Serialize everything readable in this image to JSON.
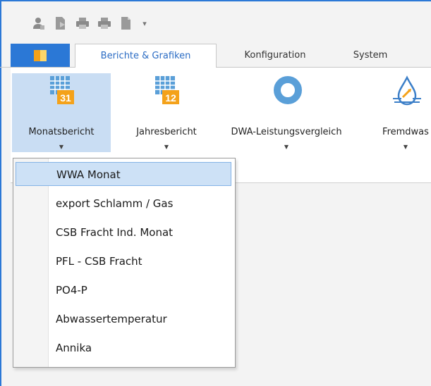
{
  "quick_access": {
    "icons": [
      "user-icon",
      "export-icon",
      "print-icon",
      "print-preview-icon",
      "document-icon"
    ],
    "customize_glyph": "▾"
  },
  "tabs": [
    {
      "label": "Berichte & Grafiken",
      "active": true
    },
    {
      "label": "Konfiguration",
      "active": false
    },
    {
      "label": "System",
      "active": false
    }
  ],
  "ribbon": {
    "buttons": [
      {
        "label": "Monatsbericht",
        "icon": "calendar-31-icon",
        "badge": "31",
        "has_dropdown": true,
        "pressed": true
      },
      {
        "label": "Jahresbericht",
        "icon": "calendar-12-icon",
        "badge": "12",
        "has_dropdown": true
      },
      {
        "label": "DWA-Leistungsvergleich",
        "icon": "ring-chart-icon",
        "has_dropdown": true
      },
      {
        "label": "Fremdwas",
        "icon": "water-drop-icon",
        "has_dropdown": true
      }
    ],
    "arrow_glyph": "▼"
  },
  "menu": {
    "items": [
      {
        "label": "WWA Monat",
        "highlighted": true
      },
      {
        "label": "export Schlamm / Gas"
      },
      {
        "label": "CSB Fracht Ind. Monat"
      },
      {
        "label": "PFL - CSB Fracht"
      },
      {
        "label": "PO4-P"
      },
      {
        "label": "Abwassertemperatur"
      },
      {
        "label": "Annika"
      }
    ]
  },
  "colors": {
    "accent": "#2b78d6",
    "pressed": "#c9ddf3",
    "highlight": "#cde1f6",
    "icon_orange": "#f4a21a"
  }
}
